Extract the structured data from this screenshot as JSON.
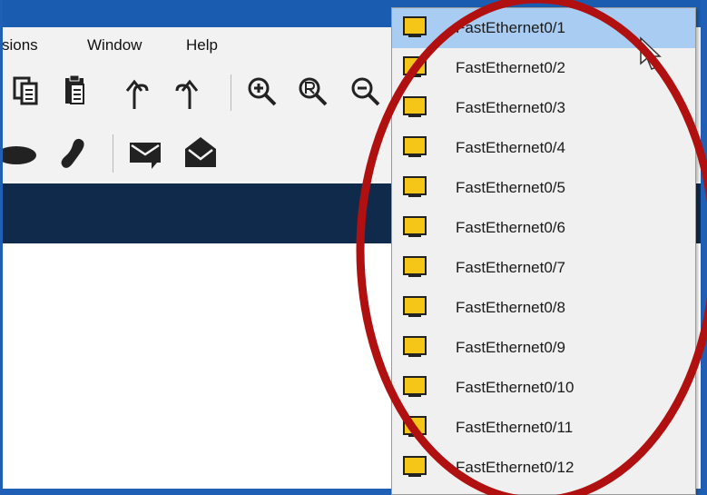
{
  "menu": {
    "items": [
      "sions",
      "Window",
      "Help"
    ]
  },
  "toolbar": {
    "icons": [
      "copy-icon",
      "paste-icon",
      "undo-icon",
      "redo-icon",
      "zoom-in-icon",
      "zoom-reset-icon",
      "zoom-out-icon"
    ]
  },
  "toolbar2": {
    "icons": [
      "ellipse-icon",
      "freeform-icon",
      "message-icon",
      "open-envelope-icon"
    ]
  },
  "dropdown": {
    "selected_index": 0,
    "items": [
      "FastEthernet0/1",
      "FastEthernet0/2",
      "FastEthernet0/3",
      "FastEthernet0/4",
      "FastEthernet0/5",
      "FastEthernet0/6",
      "FastEthernet0/7",
      "FastEthernet0/8",
      "FastEthernet0/9",
      "FastEthernet0/10",
      "FastEthernet0/11",
      "FastEthernet0/12"
    ]
  },
  "colors": {
    "port_icon": "#f5c518",
    "selection": "#a9cdf2",
    "annotation_ellipse": "#b01010",
    "navy_bar": "#102a4c",
    "window_border": "#1f5fb5"
  }
}
